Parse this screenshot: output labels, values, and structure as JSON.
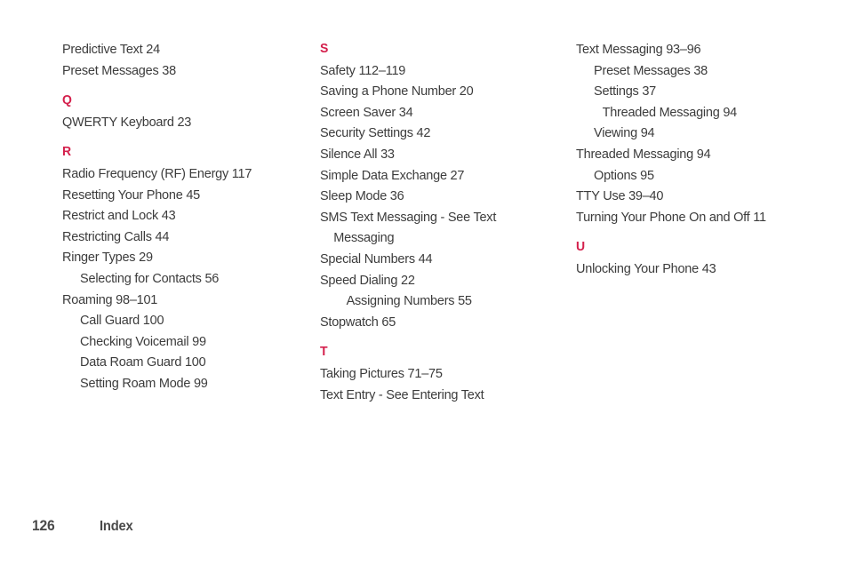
{
  "page": {
    "background_color": "#ffffff",
    "text_color": "#3c3c3c",
    "accent_color": "#d4204c"
  },
  "footer": {
    "page_number": "126",
    "section_label": "Index"
  },
  "columns": [
    {
      "id": "column-1",
      "blocks": [
        {
          "type": "entries",
          "entries": [
            {
              "text": "Predictive Text  24",
              "level": 1
            },
            {
              "text": "Preset Messages  38",
              "level": 1
            }
          ]
        },
        {
          "type": "letter",
          "letter": "Q",
          "entries": [
            {
              "text": "QWERTY Keyboard  23",
              "level": 1
            }
          ]
        },
        {
          "type": "letter",
          "letter": "R",
          "entries": [
            {
              "text": "Radio Frequency (RF) Energy  117",
              "level": 1
            },
            {
              "text": "Resetting Your Phone  45",
              "level": 1
            },
            {
              "text": "Restrict and Lock  43",
              "level": 1
            },
            {
              "text": "Restricting Calls  44",
              "level": 1
            },
            {
              "text": "Ringer Types  29",
              "level": 1
            },
            {
              "text": "Selecting for Contacts  56",
              "level": 2
            },
            {
              "text": "Roaming  98–101",
              "level": 1
            },
            {
              "text": "Call Guard  100",
              "level": 2
            },
            {
              "text": "Checking Voicemail  99",
              "level": 2
            },
            {
              "text": "Data Roam Guard  100",
              "level": 2
            },
            {
              "text": "Setting Roam Mode  99",
              "level": 2
            }
          ]
        }
      ]
    },
    {
      "id": "column-2",
      "blocks": [
        {
          "type": "letter",
          "letter": "S",
          "first": true,
          "entries": [
            {
              "text": "Safety  112–119",
              "level": 1
            },
            {
              "text": "Saving a Phone Number  20",
              "level": 1
            },
            {
              "text": "Screen Saver  34",
              "level": 1
            },
            {
              "text": "Security Settings  42",
              "level": 1
            },
            {
              "text": "Silence All  33",
              "level": 1
            },
            {
              "text": "Simple Data Exchange  27",
              "level": 1
            },
            {
              "text": "Sleep Mode  36",
              "level": 1
            },
            {
              "text": "SMS Text Messaging - See Text",
              "level": 1
            },
            {
              "text": "Messaging",
              "level": "cont"
            },
            {
              "text": "Special Numbers  44",
              "level": 1
            },
            {
              "text": "Speed Dialing  22",
              "level": 1
            },
            {
              "text": "Assigning Numbers  55",
              "level": 3
            },
            {
              "text": "Stopwatch  65",
              "level": 1
            }
          ]
        },
        {
          "type": "letter",
          "letter": "T",
          "entries": [
            {
              "text": "Taking Pictures  71–75",
              "level": 1
            },
            {
              "text": "Text Entry - See Entering Text",
              "level": 1
            }
          ]
        }
      ]
    },
    {
      "id": "column-3",
      "blocks": [
        {
          "type": "entries",
          "entries": [
            {
              "text": "Text Messaging  93–96",
              "level": 1
            },
            {
              "text": "Preset Messages  38",
              "level": 2
            },
            {
              "text": "Settings  37",
              "level": 2
            },
            {
              "text": "Threaded Messaging  94",
              "level": 3
            },
            {
              "text": "Viewing  94",
              "level": 2
            },
            {
              "text": "Threaded Messaging  94",
              "level": 1
            },
            {
              "text": "Options  95",
              "level": 2
            },
            {
              "text": "TTY Use  39–40",
              "level": 1
            },
            {
              "text": "Turning Your Phone On and Off  11",
              "level": 1
            }
          ]
        },
        {
          "type": "letter",
          "letter": "U",
          "entries": [
            {
              "text": "Unlocking Your Phone  43",
              "level": 1
            }
          ]
        }
      ]
    }
  ]
}
